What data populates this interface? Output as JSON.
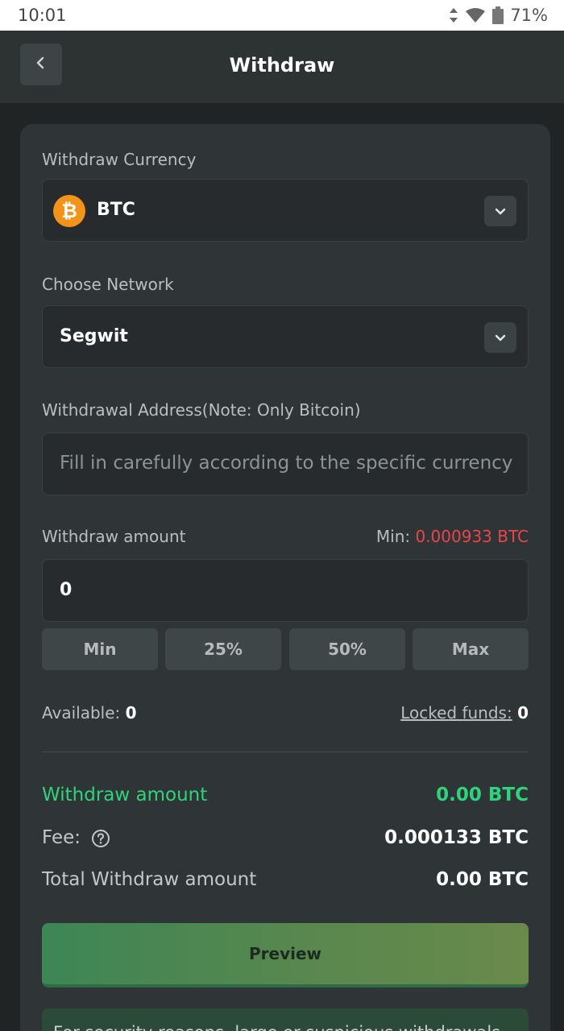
{
  "status_bar": {
    "time": "10:01",
    "battery": "71%"
  },
  "header": {
    "title": "Withdraw"
  },
  "currency": {
    "label": "Withdraw Currency",
    "value": "BTC",
    "coin_symbol": "₿",
    "coin_color": "#f4931a"
  },
  "network": {
    "label": "Choose Network",
    "value": "Segwit"
  },
  "address": {
    "label": "Withdrawal Address(Note: Only Bitcoin)",
    "placeholder": "Fill in carefully according to the specific currency"
  },
  "amount": {
    "label": "Withdraw amount",
    "min_label": "Min:",
    "min_value": "0.000933 BTC",
    "value": "0",
    "quick_buttons": [
      "Min",
      "25%",
      "50%",
      "Max"
    ]
  },
  "balances": {
    "available_label": "Available:",
    "available_value": "0",
    "locked_label": "Locked funds:",
    "locked_value": "0"
  },
  "summary": {
    "withdraw_label": "Withdraw amount",
    "withdraw_value": "0.00 BTC",
    "fee_label": "Fee:",
    "fee_value": "0.000133 BTC",
    "total_label": "Total Withdraw amount",
    "total_value": "0.00 BTC"
  },
  "preview_label": "Preview",
  "notice_text": "For security reasons, large or suspicious withdrawals",
  "colors": {
    "accent_green": "#2fd37c",
    "min_red": "#e9454a",
    "background": "#202424",
    "card": "#2f3536"
  }
}
